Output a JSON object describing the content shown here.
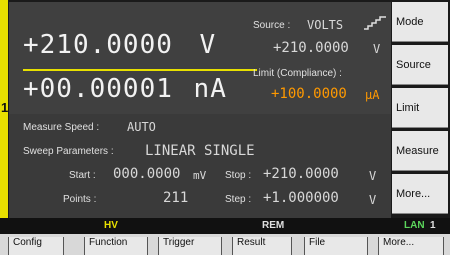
{
  "channel": {
    "number": "1"
  },
  "source": {
    "label": "Source :",
    "mode": "VOLTS",
    "value": "+210.0000",
    "unit": "V"
  },
  "limit": {
    "label": "Limit (Compliance) :",
    "value": "+100.0000",
    "unit": "µA"
  },
  "readout": {
    "voltage_value": "+210.0000",
    "voltage_unit": "V",
    "current_value": "+00.00001",
    "current_unit": "nA"
  },
  "measure_speed": {
    "label": "Measure Speed :",
    "value": "AUTO"
  },
  "sweep": {
    "label": "Sweep Parameters :",
    "value": "LINEAR SINGLE",
    "start_label": "Start :",
    "start_value": "000.0000",
    "start_unit": "mV",
    "stop_label": "Stop :",
    "stop_value": "+210.0000",
    "stop_unit": "V",
    "points_label": "Points :",
    "points_value": "211",
    "step_label": "Step :",
    "step_value": "+1.000000",
    "step_unit": "V"
  },
  "softkeys": [
    "Mode",
    "Source",
    "Limit",
    "Measure",
    "More..."
  ],
  "status": {
    "hv": "HV",
    "rem": "REM",
    "lan": "LAN",
    "lan_num": "1"
  },
  "menu": [
    "Config",
    "Function",
    "Trigger",
    "Result",
    "File",
    "More..."
  ],
  "colors": {
    "accent": "#e8e000",
    "limit_text": "#ff9900"
  }
}
